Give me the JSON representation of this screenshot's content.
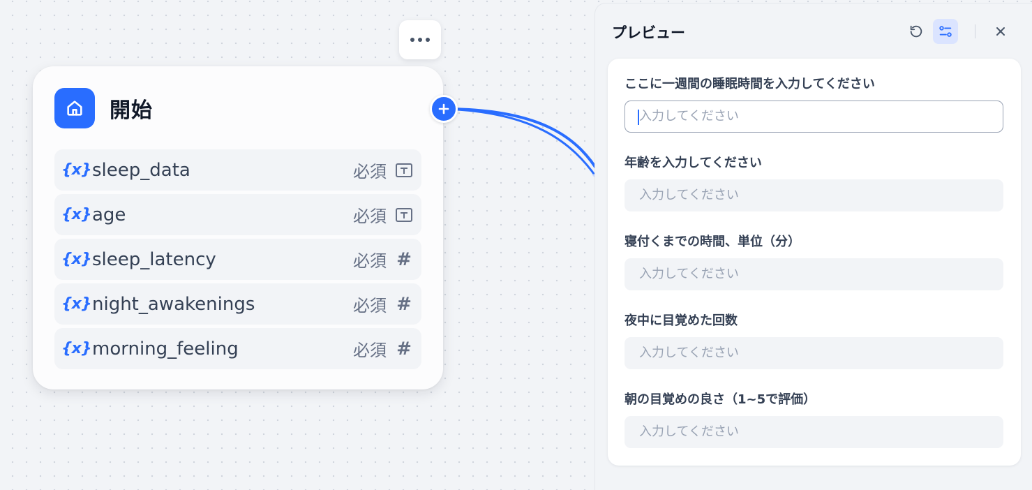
{
  "node": {
    "title": "開始",
    "variables": [
      {
        "name": "sleep_data",
        "required": "必須",
        "type_icon": "text-input-icon"
      },
      {
        "name": "age",
        "required": "必須",
        "type_icon": "text-input-icon"
      },
      {
        "name": "sleep_latency",
        "required": "必須",
        "type_icon": "number-icon"
      },
      {
        "name": "night_awakenings",
        "required": "必須",
        "type_icon": "number-icon"
      },
      {
        "name": "morning_feeling",
        "required": "必須",
        "type_icon": "number-icon"
      }
    ],
    "variable_icon": "{x}",
    "number_glyph": "#"
  },
  "panel": {
    "title": "プレビュー",
    "fields": [
      {
        "label": "ここに一週間の睡眠時間を入力してください",
        "placeholder": "入力してください"
      },
      {
        "label": "年齢を入力してください",
        "placeholder": "入力してください"
      },
      {
        "label": "寝付くまでの時間、単位（分）",
        "placeholder": "入力してください"
      },
      {
        "label": "夜中に目覚めた回数",
        "placeholder": "入力してください"
      },
      {
        "label": "朝の目覚めの良さ（1~5で評価）",
        "placeholder": "入力してください"
      }
    ]
  },
  "colors": {
    "accent": "#296dff",
    "canvas": "#f2f4f7"
  }
}
